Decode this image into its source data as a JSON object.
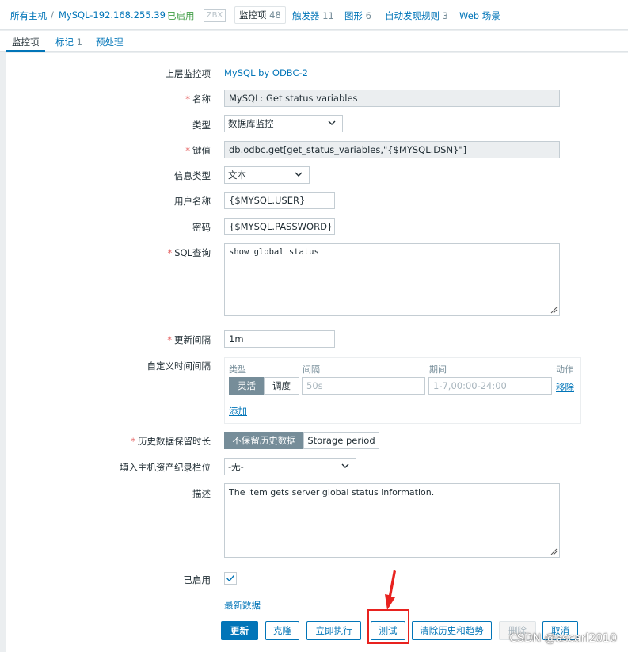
{
  "breadcrumb": {
    "all_hosts": "所有主机",
    "separator": "/",
    "host": "MySQL-192.168.255.39",
    "status": "已启用",
    "zbx_badge": "ZBX",
    "items_label": "监控项",
    "items_count": "48",
    "triggers_label": "触发器",
    "triggers_count": "11",
    "graphs_label": "图形",
    "graphs_count": "6",
    "discovery_label": "自动发现规则",
    "discovery_count": "3",
    "web_label": "Web 场景"
  },
  "tabs": {
    "item": "监控项",
    "tags_label": "标记",
    "tags_count": "1",
    "preprocessing": "预处理"
  },
  "form": {
    "parent_item_label": "上层监控项",
    "parent_item_value": "MySQL by ODBC-2",
    "name_label": "名称",
    "name_value": "MySQL: Get status variables",
    "type_label": "类型",
    "type_value": "数据库监控",
    "key_label": "键值",
    "key_value": "db.odbc.get[get_status_variables,\"{$MYSQL.DSN}\"]",
    "info_type_label": "信息类型",
    "info_type_value": "文本",
    "username_label": "用户名称",
    "username_value": "{$MYSQL.USER}",
    "password_label": "密码",
    "password_value": "{$MYSQL.PASSWORD}",
    "sql_label": "SQL查询",
    "sql_value": "show global status",
    "interval_label": "更新间隔",
    "interval_value": "1m",
    "custom_intervals_label": "自定义时间间隔",
    "custom_intervals": {
      "col_type": "类型",
      "col_interval": "间隔",
      "col_period": "期间",
      "col_action": "动作",
      "flexible": "灵活",
      "scheduling": "调度",
      "interval_placeholder": "50s",
      "period_placeholder": "1-7,00:00-24:00",
      "remove": "移除",
      "add": "添加"
    },
    "history_label": "历史数据保留时长",
    "history_option_off": "不保留历史数据",
    "history_option_period": "Storage period",
    "inventory_label": "填入主机资产纪录栏位",
    "inventory_value": "-无-",
    "description_label": "描述",
    "description_value": "The item gets server global status information.",
    "enabled_label": "已启用",
    "enabled_checked": true,
    "latest_data_link": "最新数据"
  },
  "buttons": {
    "update": "更新",
    "clone": "克隆",
    "execute_now": "立即执行",
    "test": "测试",
    "clear_history": "清除历史和趋势",
    "delete": "删除",
    "cancel": "取消"
  },
  "watermark": "CSDN @ascarl2010",
  "colors": {
    "accent": "#0275b8",
    "required": "#e45959",
    "enabled": "#429e47",
    "annotation": "#e8221f"
  }
}
